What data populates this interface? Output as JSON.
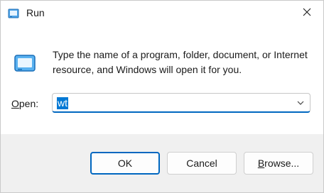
{
  "window": {
    "title": "Run",
    "icon": "run-icon",
    "close_icon": "close-icon"
  },
  "content": {
    "description": "Type the name of a program, folder, document, or Internet resource, and Windows will open it for you.",
    "open_label_key": "O",
    "open_label_rest": "pen:",
    "input_value": "wt",
    "dropdown_icon": "chevron-down-icon"
  },
  "buttons": {
    "ok": "OK",
    "cancel": "Cancel",
    "browse_key": "B",
    "browse_rest": "rowse..."
  },
  "colors": {
    "accent": "#0067c0",
    "selection": "#0078d4",
    "footer_bg": "#f0f0f0"
  }
}
